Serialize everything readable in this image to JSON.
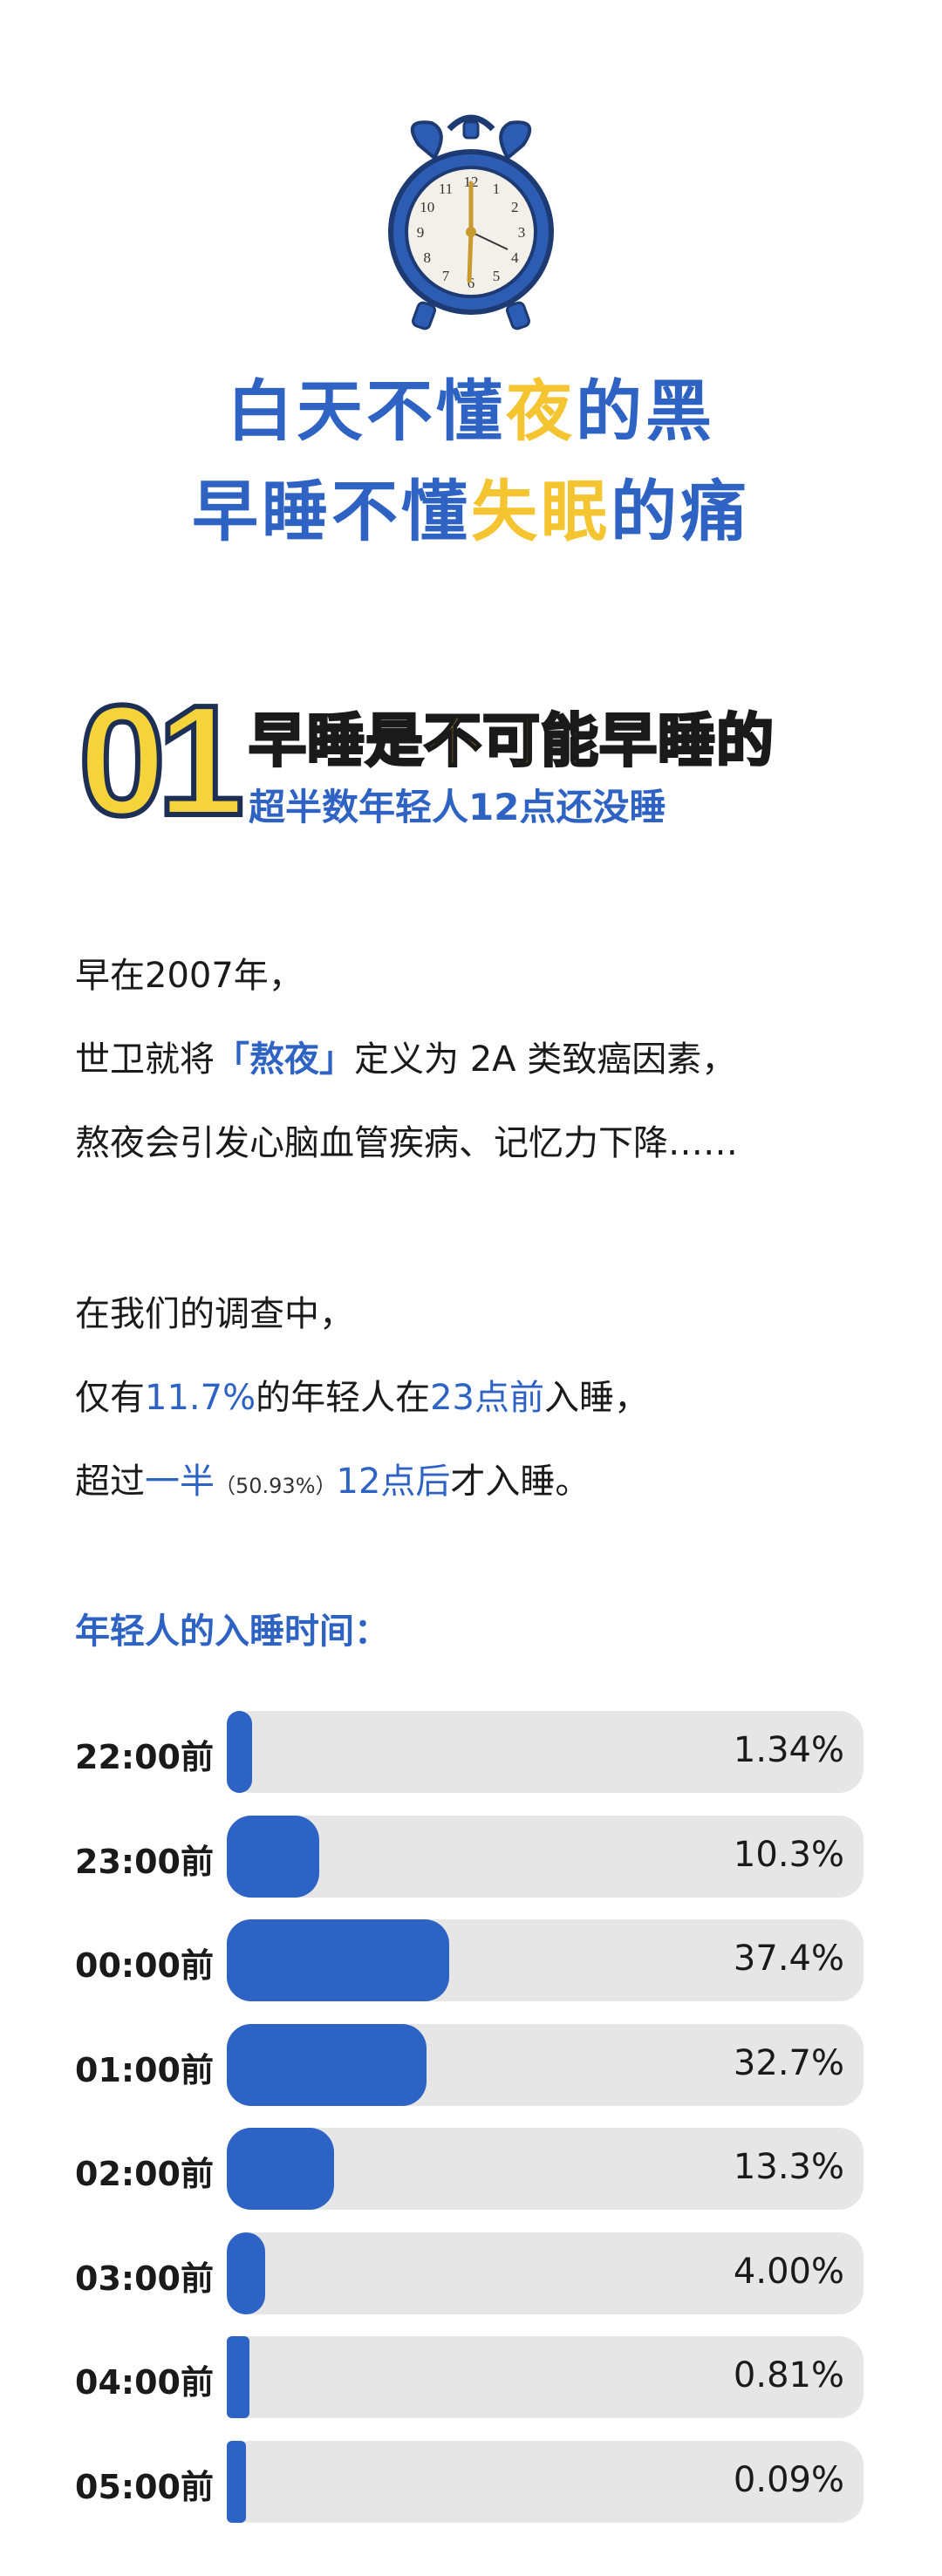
{
  "hero": {
    "line1": [
      {
        "text": "白天不懂",
        "color": "blue"
      },
      {
        "text": "夜",
        "color": "gold"
      },
      {
        "text": "的黑",
        "color": "blue"
      }
    ],
    "line2": [
      {
        "text": "早睡不懂",
        "color": "blue"
      },
      {
        "text": "失眠",
        "color": "gold"
      },
      {
        "text": "的痛",
        "color": "blue"
      }
    ]
  },
  "section": {
    "number": "01",
    "title": "早睡是不可能早睡的",
    "subtitle": "超半数年轻人12点还没睡"
  },
  "paragraphs": {
    "p1a": "早在2007年，",
    "p1b_pre": "世卫就将",
    "p1b_hl": "「熬夜」",
    "p1b_post": "定义为 2A 类致癌因素，",
    "p1c": "熬夜会引发心脑血管疾病、记忆力下降……",
    "p2a": "在我们的调查中，",
    "p2b_pre": "仅有",
    "p2b_hl1": "11.7%",
    "p2b_mid": "的年轻人在",
    "p2b_hl2": "23点前",
    "p2b_post": "入睡，",
    "p2c_pre": "超过",
    "p2c_hl1": "一半",
    "p2c_small": "（50.93%）",
    "p2c_hl2": "12点后",
    "p2c_post": "才入睡。"
  },
  "clock": {
    "numbers": [
      "12",
      "1",
      "2",
      "3",
      "4",
      "5",
      "6",
      "7",
      "8",
      "9",
      "10",
      "11"
    ]
  },
  "colors": {
    "accent": "#2e63c3",
    "gold": "#f5c531",
    "track": "#e6e6e6"
  },
  "chart_data": {
    "type": "bar",
    "title": "年轻人的入睡时间：",
    "categories": [
      "22:00前",
      "23:00前",
      "00:00前",
      "01:00前",
      "02:00前",
      "03:00前",
      "04:00前",
      "05:00前"
    ],
    "values": [
      1.34,
      10.3,
      37.4,
      32.7,
      13.3,
      4.0,
      0.81,
      0.09
    ],
    "value_labels": [
      "1.34%",
      "10.3%",
      "37.4%",
      "32.7%",
      "13.3%",
      "4.00%",
      "0.81%",
      "0.09%"
    ],
    "unit": "%",
    "orientation": "horizontal"
  }
}
